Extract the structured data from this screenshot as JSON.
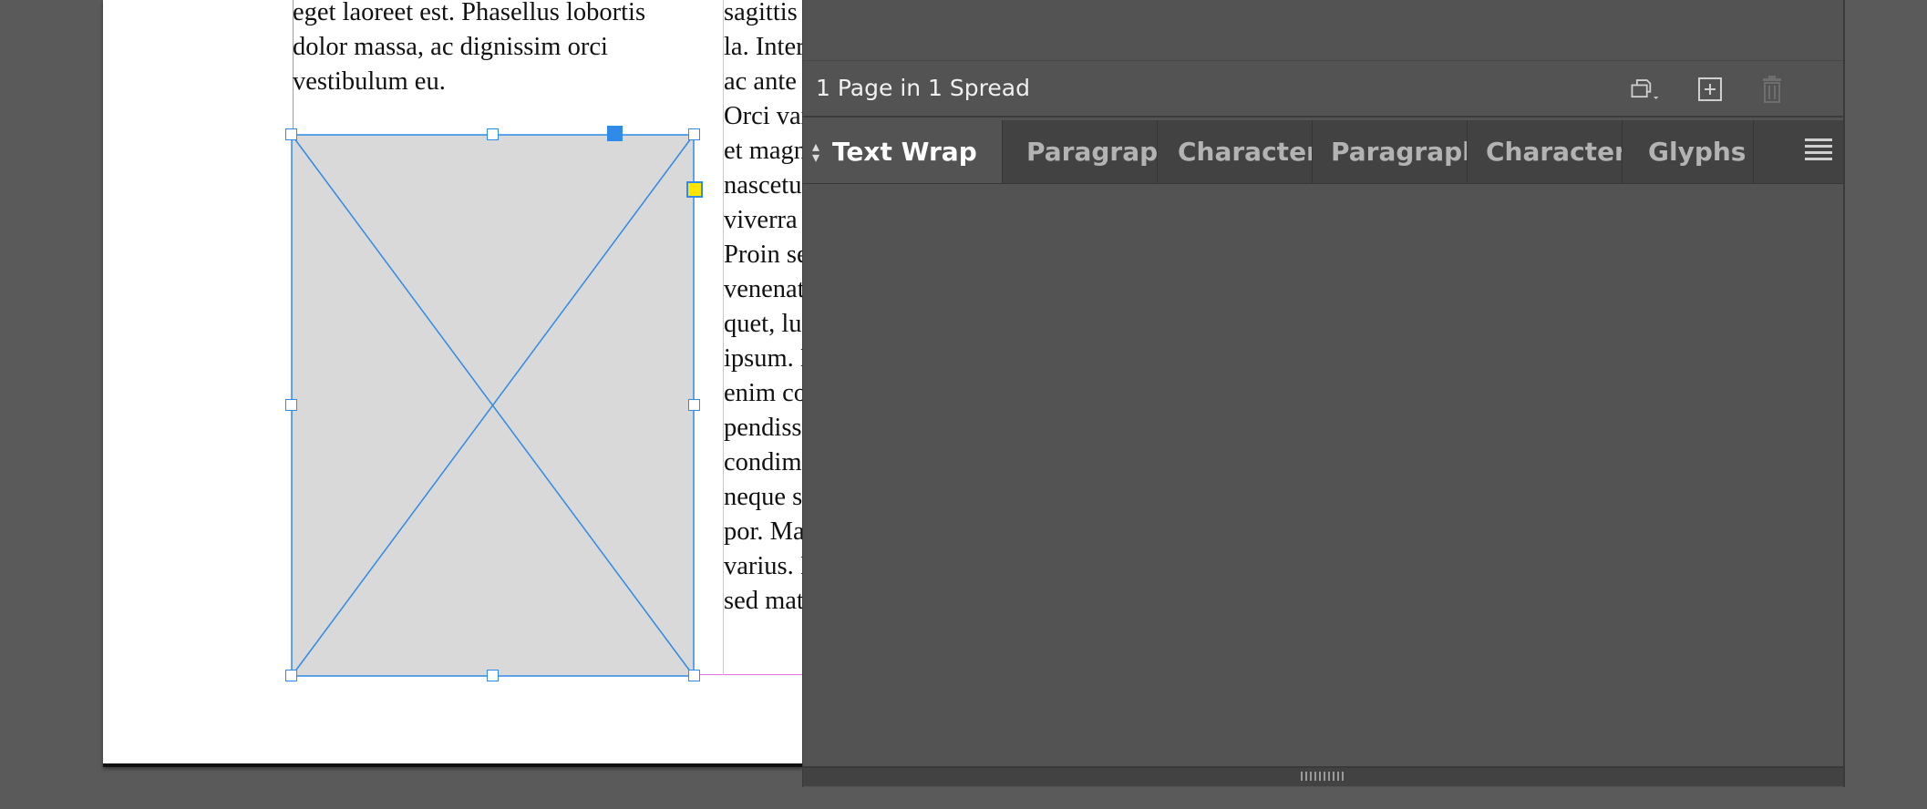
{
  "document": {
    "column1_lines": [
      "eget laoreet est. Phasellus lobortis",
      "dolor massa, ac dignissim orci",
      "vestibulum eu."
    ],
    "column2_lines": [
      "sagittis rutrum n",
      "la. Interdum et m",
      "ac ante ipsum p",
      "Orci varius nato",
      "et magnis dis pa",
      "nascetur ridicul",
      "viverra vestibulu",
      "Proin sed tellus",
      "venenatis. Praes",
      "quet, luctus null",
      "ipsum. Mauris h",
      "enim commodo",
      "pendisse sagittis",
      "condimentum. I",
      "neque sit amet l",
      "por. Mauris volu",
      "varius. In eget n",
      "sed mattis enim"
    ],
    "colors": {
      "frame_stroke": "#2f8ae8",
      "frame_fill": "#d9d9d9",
      "margin_guide": "#e36fd8",
      "anchor_point": "#ffe400"
    }
  },
  "panel": {
    "pages_label": "1 Page in 1 Spread",
    "buttons": {
      "edit_page_size": "edit-page-size-icon",
      "new_page": "new-page-icon",
      "delete_page": "trash-icon"
    },
    "tabs": [
      {
        "label": "Text Wrap",
        "active": true
      },
      {
        "label": "Paragraph",
        "active": false
      },
      {
        "label": "Character",
        "active": false
      },
      {
        "label": "Paragraph",
        "active": false
      },
      {
        "label": "Character",
        "active": false
      },
      {
        "label": "Glyphs",
        "active": false
      }
    ],
    "menu_icon": "panel-menu-icon"
  }
}
